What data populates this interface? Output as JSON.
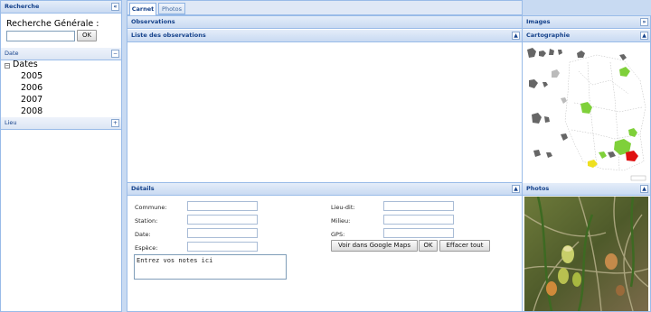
{
  "left": {
    "title": "Recherche",
    "search_label": "Recherche Générale :",
    "ok_label": "OK",
    "date_section": "Date",
    "date_root": "Dates",
    "years": [
      "2005",
      "2006",
      "2007",
      "2008"
    ],
    "lieu_section": "Lieu"
  },
  "tabs": [
    "Carnet",
    "Photos"
  ],
  "obs": {
    "title": "Observations",
    "list_title": "Liste des observations"
  },
  "details": {
    "title": "Détails",
    "fields_left": [
      "Commune:",
      "Station:",
      "Date:",
      "Espèce:"
    ],
    "fields_right": [
      "Lieu-dit:",
      "Milieu:",
      "GPS:"
    ],
    "notes_placeholder": "Entrez vos notes ici",
    "btn_maps": "Voir dans Google Maps",
    "btn_ok": "OK",
    "btn_clear": "Effacer tout"
  },
  "right": {
    "images_title": "Images",
    "carto_title": "Cartographie",
    "photos_title": "Photos"
  },
  "colors": {
    "header_text": "#15428b",
    "region_green": "#7fd03a",
    "region_red": "#e01010",
    "region_yellow": "#eee020"
  }
}
